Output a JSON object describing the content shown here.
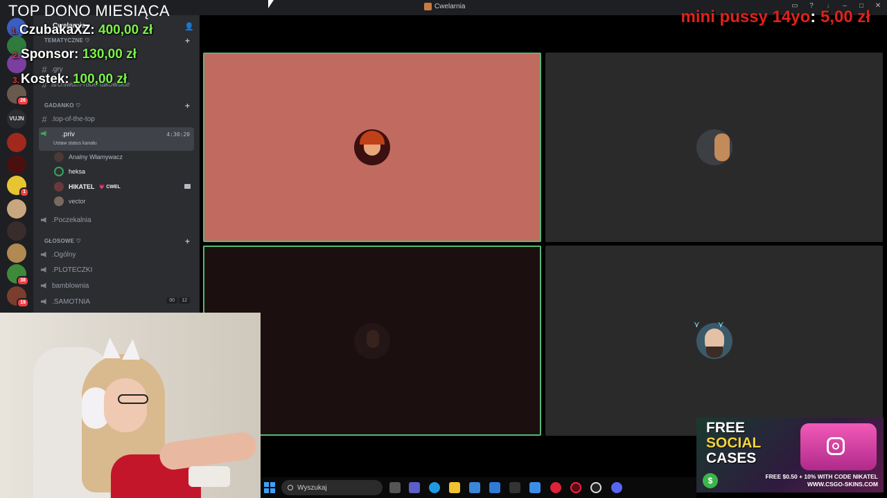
{
  "window": {
    "title": "Cwelarnia"
  },
  "overlay": {
    "heading": "TOP DONO MIESIĄCA",
    "donors": [
      {
        "rank": "1.",
        "name": "CzubakaXZ:",
        "amount": "400,00 zł"
      },
      {
        "rank": "2.",
        "name": "Sponsor:",
        "amount": "130,00 zł"
      },
      {
        "rank": "3.",
        "name": "Kostek:",
        "amount": "100,00 zł"
      }
    ],
    "cut_off_row": "Cwelarnia",
    "alert": {
      "name": "mini pussy 14yo",
      "amount": "5,00 zł"
    }
  },
  "servers": [
    {
      "label": "",
      "badge": "",
      "color": "#3b5ec2"
    },
    {
      "label": "",
      "badge": "",
      "color": "#2f7a3d"
    },
    {
      "label": "",
      "badge": "",
      "color": "#7b3fa0"
    },
    {
      "label": "",
      "badge": "26",
      "color": "#6a5a4e"
    },
    {
      "label": "VUJN",
      "badge": "",
      "color": "#2b2d31"
    },
    {
      "label": "",
      "badge": "",
      "color": "#a0281c"
    },
    {
      "label": "",
      "badge": "",
      "color": "#4a1010"
    },
    {
      "label": "",
      "badge": "1",
      "color": "#e7c532"
    },
    {
      "label": "",
      "badge": "",
      "color": "#c9a77e"
    },
    {
      "label": "",
      "badge": "",
      "color": "#3a2c2c"
    },
    {
      "label": "",
      "badge": "",
      "color": "#b08a50"
    },
    {
      "label": "",
      "badge": "38",
      "color": "#3d8a3a"
    },
    {
      "label": "",
      "badge": "19",
      "color": "#7a3d2e"
    }
  ],
  "sidebar": {
    "server_name": "Cwelarnia",
    "categories": [
      {
        "name": "TEMATYCZNE ♡"
      },
      {
        "name": "GADANKO ♡"
      },
      {
        "name": "GŁOSOWE ♡"
      }
    ],
    "text_channels": [
      {
        "name": ".gry"
      },
      {
        "name": "archiwum-robertakowskie"
      },
      {
        "name": ".top-of-the-top"
      }
    ],
    "active_channel": {
      "name": ".priv",
      "time": "4:30:20",
      "status": "Ustaw status kanału"
    },
    "voice_users": [
      {
        "name": "Analny Włamywacz",
        "color": "#4b3a35"
      },
      {
        "name": "heksa",
        "color": "#2f3136"
      },
      {
        "name": "НІКАТЕL",
        "tag": "💗 CWEL",
        "color": "#6a3a3a"
      },
      {
        "name": "vector",
        "color": "#7a6a5e"
      }
    ],
    "voice_channels": [
      {
        "name": ".Poczekalnia"
      },
      {
        "name": ".Ogólny"
      },
      {
        "name": ".PLOTECZKI"
      },
      {
        "name": "bamblownia"
      },
      {
        "name": ".SAMOTNIA",
        "count_a": "00",
        "count_b": "12"
      }
    ]
  },
  "video_tiles": [
    {
      "avatar_color": "#3a1010",
      "speaking": true
    },
    {
      "avatar_color": "#3c3f44",
      "speaking": false
    },
    {
      "avatar_color": "#2a1b1b",
      "speaking": true
    },
    {
      "avatar_color": "#d9b8a4",
      "speaking": false
    }
  ],
  "taskbar": {
    "search_placeholder": "Wyszukaj",
    "apps": [
      "file-explorer-icon",
      "teams-icon",
      "edge-icon",
      "folder-icon",
      "store-icon",
      "mail-icon",
      "g-icon",
      "window-icon",
      "opera-icon",
      "opera-gx-icon",
      "obs-icon",
      "discord-icon"
    ]
  },
  "ad": {
    "line1": "FREE",
    "line2": "SOCIAL",
    "line3": "CASES",
    "promo": "FREE $0.50 + 10% WITH CODE NIKATEL",
    "url": "WWW.CSGO-SKINS.COM"
  }
}
